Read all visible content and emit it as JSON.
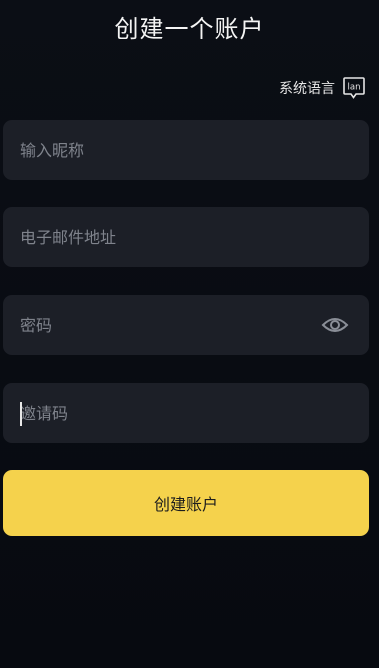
{
  "header": {
    "title": "创建一个账户"
  },
  "language": {
    "label": "系统语言",
    "icon": "language-icon",
    "icon_text": "lan"
  },
  "form": {
    "nickname_placeholder": "输入昵称",
    "email_placeholder": "电子邮件地址",
    "password_placeholder": "密码",
    "password_toggle_icon": "eye-icon",
    "invite_placeholder": "邀请码"
  },
  "actions": {
    "submit_label": "创建账户"
  },
  "colors": {
    "background": "#090c13",
    "field_background": "#1c1f27",
    "accent": "#f5d24c"
  }
}
